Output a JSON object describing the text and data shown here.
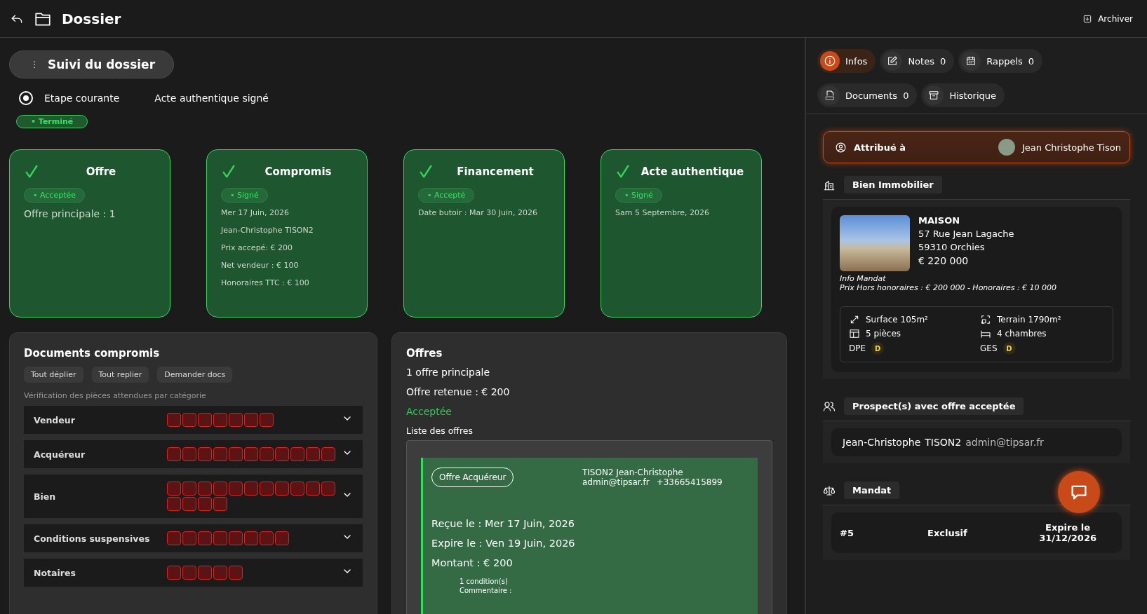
{
  "header": {
    "title": "Dossier",
    "archive_button": "Archiver"
  },
  "tracking": {
    "menu_button": "Suivi du dossier",
    "current_step_selected": true,
    "current_step_label": "Etape courante",
    "current_step": "Acte authentique signé",
    "status": "• Terminé"
  },
  "stages": [
    {
      "title": "Offre",
      "done": true,
      "status": "• Acceptée",
      "kind": "summary",
      "lines": [
        "Offre principale : 1"
      ]
    },
    {
      "title": "Compromis",
      "done": true,
      "status": "• Signé",
      "kind": "details",
      "lines": [
        "Mer 17 Juin, 2026",
        "Jean-Christophe TISON2",
        "Prix accepé: €  200",
        "Net vendeur : € 100",
        "Honoraires TTC : € 100"
      ]
    },
    {
      "title": "Financement",
      "done": true,
      "status": "• Accepté",
      "kind": "details",
      "lines": [
        "Date butoir : Mar 30 Juin, 2026"
      ]
    },
    {
      "title": "Acte authentique",
      "done": true,
      "status": "• Signé",
      "kind": "details",
      "lines": [
        "Sam 5 Septembre, 2026"
      ]
    }
  ],
  "documents": {
    "title": "Documents compromis",
    "actions": [
      "Tout déplier",
      "Tout replier",
      "Demander docs"
    ],
    "hint": "Vérification des pièces attendues par catégorie",
    "categories": [
      {
        "label": "Vendeur",
        "pieces": [
          {
            "received": false
          },
          {
            "received": false
          },
          {
            "received": false
          },
          {
            "received": false
          },
          {
            "received": false
          },
          {
            "received": false
          },
          {
            "received": false
          }
        ]
      },
      {
        "label": "Acquéreur",
        "pieces": [
          {
            "received": false
          },
          {
            "received": false
          },
          {
            "received": false
          },
          {
            "received": false
          },
          {
            "received": false
          },
          {
            "received": false
          },
          {
            "received": false
          },
          {
            "received": false
          },
          {
            "received": false
          },
          {
            "received": false
          },
          {
            "received": false
          }
        ]
      },
      {
        "label": "Bien",
        "pieces": [
          {
            "received": false
          },
          {
            "received": false
          },
          {
            "received": false
          },
          {
            "received": false
          },
          {
            "received": false
          },
          {
            "received": false
          },
          {
            "received": false
          },
          {
            "received": false
          },
          {
            "received": false
          },
          {
            "received": false
          },
          {
            "received": false
          },
          {
            "received": false
          },
          {
            "received": false
          },
          {
            "received": false
          },
          {
            "received": false
          }
        ]
      },
      {
        "label": "Conditions suspensives",
        "pieces": [
          {
            "received": false
          },
          {
            "received": false
          },
          {
            "received": false
          },
          {
            "received": false
          },
          {
            "received": false
          },
          {
            "received": false
          },
          {
            "received": false
          },
          {
            "received": false
          }
        ]
      },
      {
        "label": "Notaires",
        "pieces": [
          {
            "received": false
          },
          {
            "received": false
          },
          {
            "received": false
          },
          {
            "received": false
          },
          {
            "received": false
          }
        ]
      }
    ]
  },
  "offers": {
    "title": "Offres",
    "count": "1 offre principale",
    "retained": "Offre retenue : €  200",
    "status": "Acceptée",
    "list_label": "Liste des offres",
    "items": [
      {
        "badge": "Offre Acquéreur",
        "name": "TISON2 Jean-Christophe",
        "email": "admin@tipsar.fr",
        "phone": "+33665415899",
        "received": "Reçue le : Mer 17 Juin, 2026",
        "expires": "Expire le : Ven 19 Juin, 2026",
        "amount": "Montant : €  200",
        "conditions": "1 condition(s)",
        "comment": "Commentaire :"
      }
    ]
  },
  "side_tabs": [
    {
      "label": "Infos",
      "selected": true
    },
    {
      "label": "Notes",
      "count": "0",
      "selected": false
    },
    {
      "label": "Rappels",
      "count": "0",
      "selected": false
    },
    {
      "label": "Documents",
      "count": "0",
      "selected": false
    },
    {
      "label": "Historique",
      "selected": false
    }
  ],
  "assigned": {
    "label": "Attribué à",
    "user": "Jean Christophe Tison"
  },
  "property": {
    "heading": "Bien Immobilier",
    "type": "MAISON",
    "street": "57 Rue Jean Lagache",
    "city": "59310 Orchies",
    "price": "€  220 000",
    "mandate_title": "Info Mandat",
    "mandate_prices": "Prix Hors honoraires : €  200 000 - Honoraires : €  10 000",
    "features": [
      "Surface 105m²",
      "Terrain 1790m²",
      "5 pièces",
      "4 chambres"
    ],
    "energy": [
      {
        "label": "DPE",
        "grade": "D"
      },
      {
        "label": "GES",
        "grade": "D"
      }
    ]
  },
  "prospects": {
    "heading": "Prospect(s) avec offre acceptée",
    "items": [
      {
        "first_name": "Jean-Christophe",
        "last_name": "TISON2",
        "email": "admin@tipsar.fr"
      }
    ]
  },
  "mandate": {
    "heading": "Mandat",
    "number": "#5",
    "type": "Exclusif",
    "expiry_label": "Expire le",
    "expiry_date": "31/12/2026"
  }
}
